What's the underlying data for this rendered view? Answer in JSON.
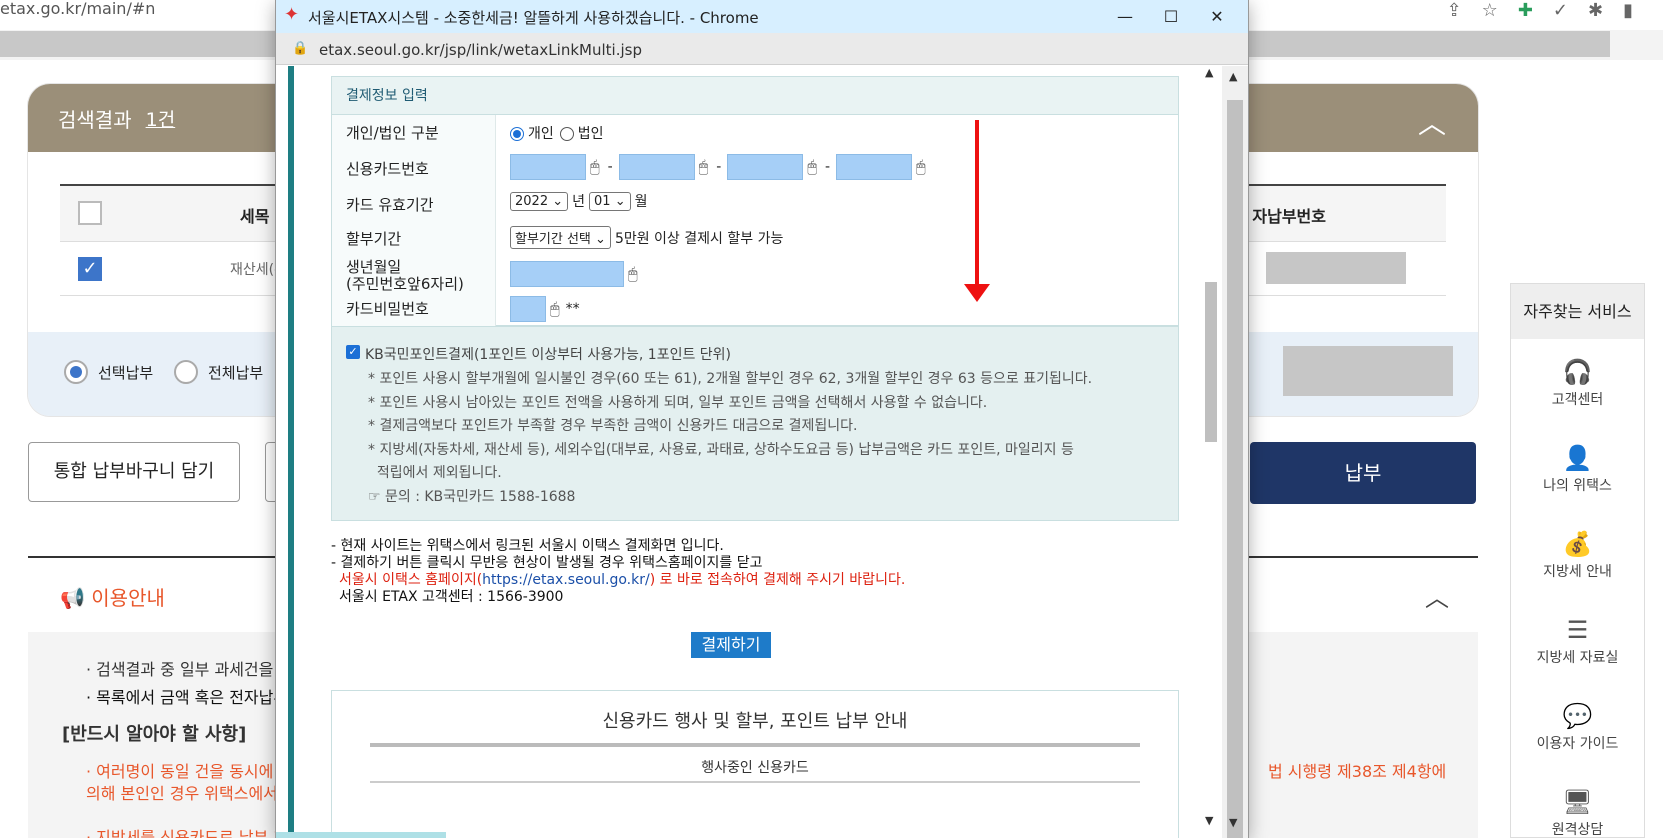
{
  "main": {
    "url": "etax.go.kr/main/#n",
    "result_title": "검색결과",
    "result_count": "1건",
    "col_tax": "세목",
    "col_number": "자납부번호",
    "row_tax": "재산세(주택",
    "opt_selected": "선택납부",
    "opt_all": "전체납부",
    "btn_basket": "통합 납부바구니 담기",
    "btn_pay": "납부",
    "guide_title": "이용안내",
    "guide_lines": [
      "· 검색결과 중 일부 과세건을 납",
      "· 목록에서 금액 혹은 전자납부번",
      "[반드시 알아야 할 사항]",
      "· 여러명이 동일 건을 동시에 납",
      "  의해 본인인 경우 위택스에서 ",
      "· 지방세를 신용카드로 납부 후에"
    ],
    "guide_right_1": "법 시행령 제38조 제4항에",
    "side_title": "자주찾는 서비스",
    "side_items": [
      {
        "label": "고객센터",
        "icon": "headset-icon"
      },
      {
        "label": "나의 위택스",
        "icon": "person-icon"
      },
      {
        "label": "지방세 안내",
        "icon": "money-bag-icon"
      },
      {
        "label": "지방세 자료실",
        "icon": "list-icon"
      },
      {
        "label": "이용자 가이드",
        "icon": "chat-icon"
      },
      {
        "label": "원격상담",
        "icon": "monitor-icon"
      }
    ]
  },
  "popup": {
    "title": "서울시ETAX시스템 - 소중한세금! 알뜰하게 사용하겠습니다. - Chrome",
    "url": "etax.seoul.go.kr/jsp/link/wetaxLinkMulti.jsp",
    "form_title": "결제정보 입력",
    "labels": {
      "type": "개인/법인 구분",
      "card": "신용카드번호",
      "expiry": "카드 유효기간",
      "install": "할부기간",
      "birth": "생년월일",
      "birth_sub": "(주민번호앞6자리)",
      "pin": "카드비밀번호"
    },
    "type_personal": "개인",
    "type_corp": "법인",
    "expiry_year": "2022",
    "year_unit": "년",
    "expiry_month": "01",
    "month_unit": "월",
    "install_select": "할부기간 선택",
    "install_note": "5만원 이상 결제시 할부 가능",
    "pin_suffix": "**",
    "kb_title": "KB국민포인트결제(1포인트 이상부터 사용가능, 1포인트 단위)",
    "kb_lines": [
      "* 포인트 사용시 할부개월에 일시불인 경우(60 또는 61), 2개월 할부인 경우 62, 3개월 할부인 경우 63 등으로 표기됩니다.",
      "* 포인트 사용시 남아있는 포인트 전액을 사용하게 되며, 일부 포인트 금액을 선택해서 사용할 수 없습니다.",
      "* 결제금액보다 포인트가 부족할 경우 부족한 금액이 신용카드 대금으로 결제됩니다.",
      "* 지방세(자동차세, 재산세 등), 세외수입(대부료, 사용료, 과태료, 상하수도요금 등) 납부금액은 카드 포인트, 마일리지 등",
      "  적립에서 제외됩니다.",
      "☞ 문의 : KB국민카드 1588-1688"
    ],
    "notice_1": "- 현재 사이트는 위택스에서 링크된 서울시 이택스 결제화면 입니다.",
    "notice_2": "- 결제하기 버튼 클릭시 무반응 현상이 발생될 경우 위택스홈페이지를 닫고",
    "notice_3a": "서울시 이택스 홈페이지(",
    "notice_3b": "https://etax.seoul.go.kr/",
    "notice_3c": ") 로 바로 접속하여 결제해 주시기 바랍니다.",
    "notice_4": "서울시 ETAX 고객센터 : 1566-3900",
    "pay_button": "결제하기",
    "event_title": "신용카드 행사 및 할부, 포인트 납부 안내",
    "event_sub": "행사중인 신용카드"
  },
  "colors": {
    "accent_teal": "#1e7e83",
    "card_input": "#a6cff7",
    "pay_button": "#1e7bc9",
    "arrow": "#e11111",
    "header_brown": "#9b8f79",
    "navy": "#1f3667"
  }
}
